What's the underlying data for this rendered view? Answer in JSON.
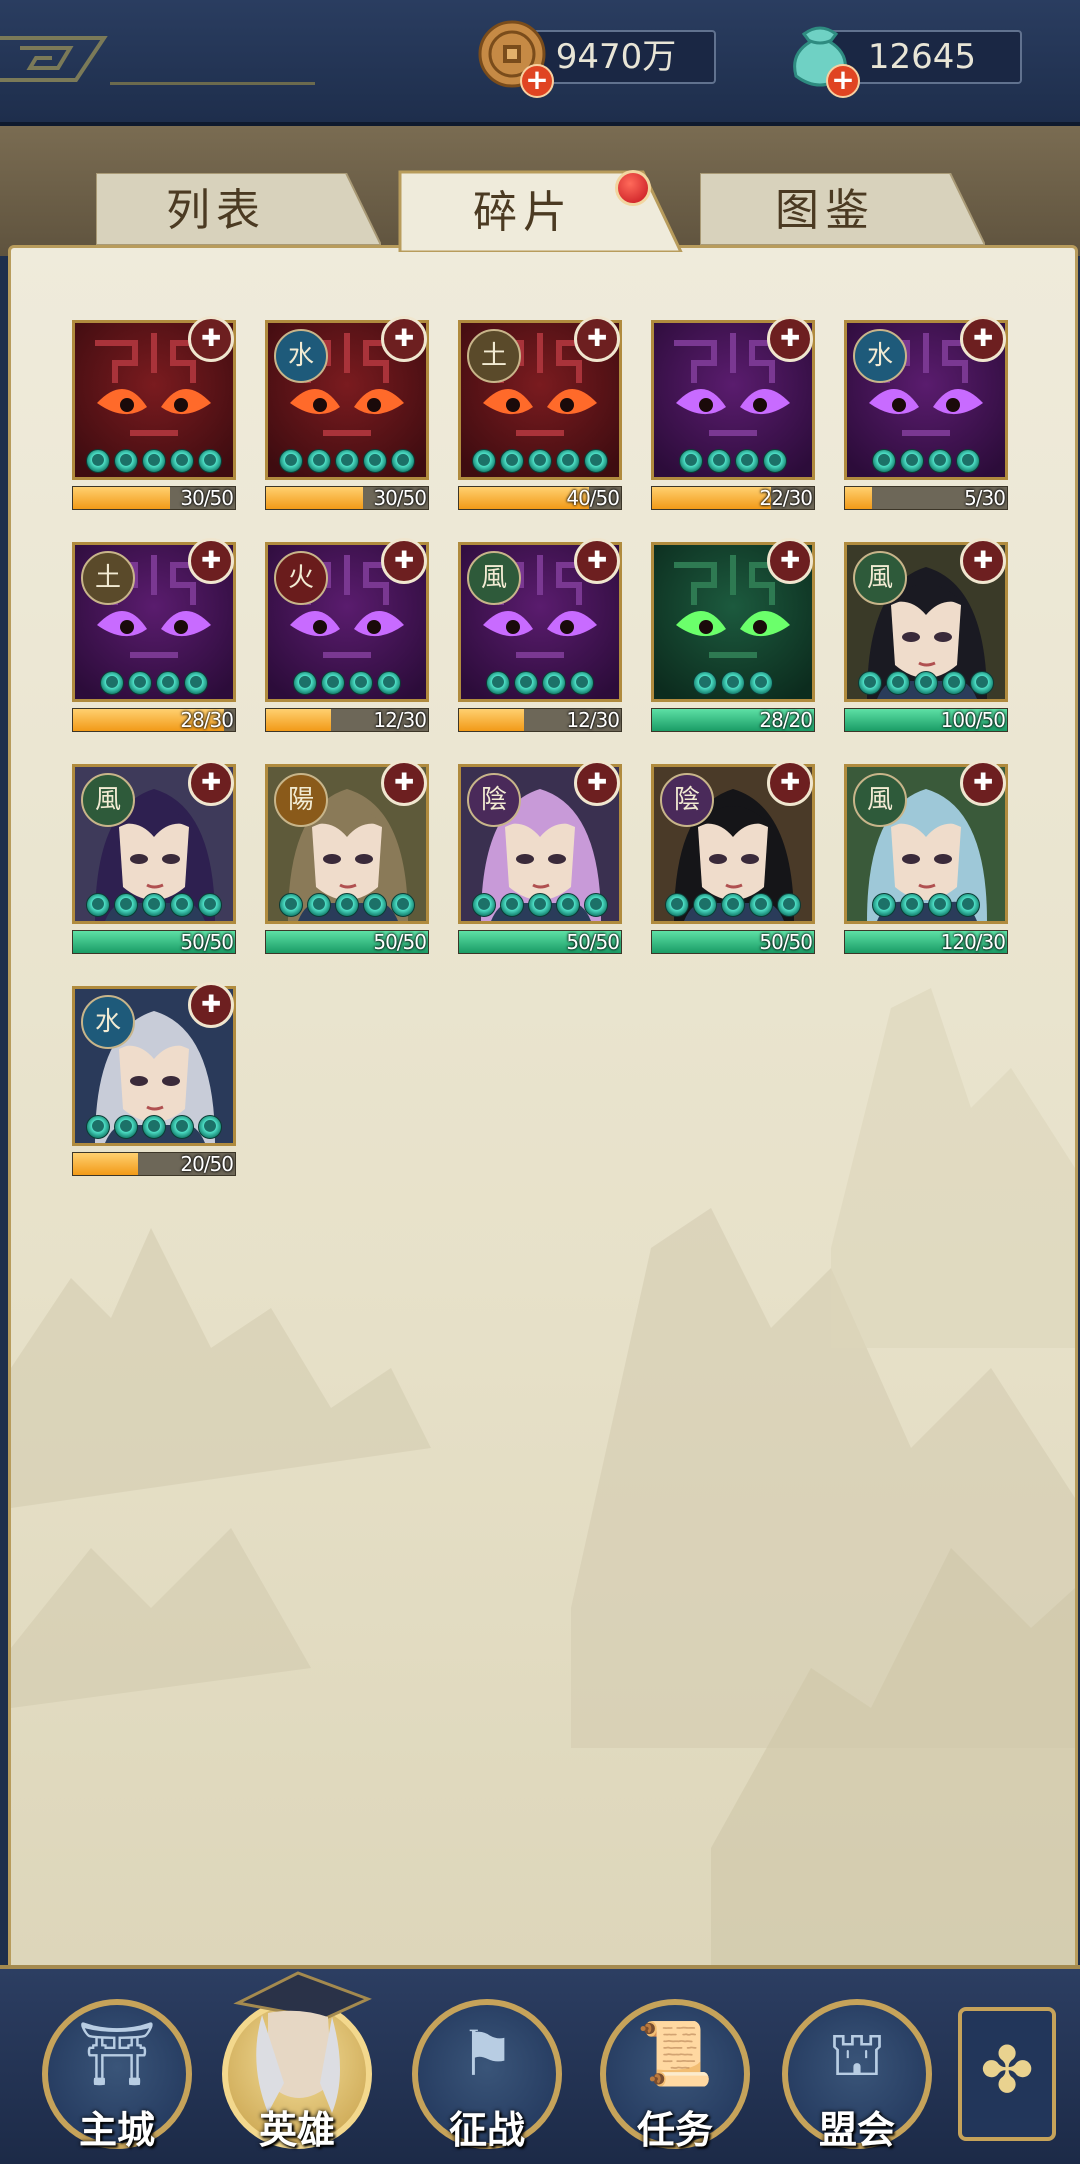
{
  "resources": {
    "coins": "9470万",
    "jade": "12645"
  },
  "tabs": [
    {
      "label": "列表"
    },
    {
      "label": "碎片"
    },
    {
      "label": "图鉴"
    }
  ],
  "active_tab": "碎片",
  "fragments": [
    {
      "element": "",
      "stars": 5,
      "current": 30,
      "required": 50,
      "progress": "30/50",
      "bar_color": "orange",
      "portrait": "red-mask"
    },
    {
      "element": "水",
      "stars": 5,
      "current": 30,
      "required": 50,
      "progress": "30/50",
      "bar_color": "orange",
      "portrait": "red-mask"
    },
    {
      "element": "土",
      "stars": 5,
      "current": 40,
      "required": 50,
      "progress": "40/50",
      "bar_color": "orange",
      "portrait": "red-mask"
    },
    {
      "element": "",
      "stars": 4,
      "current": 22,
      "required": 30,
      "progress": "22/30",
      "bar_color": "orange",
      "portrait": "purple-mask"
    },
    {
      "element": "水",
      "stars": 4,
      "current": 5,
      "required": 30,
      "progress": "5/30",
      "bar_color": "orange",
      "portrait": "purple-mask"
    },
    {
      "element": "土",
      "stars": 4,
      "current": 28,
      "required": 30,
      "progress": "28/30",
      "bar_color": "orange",
      "portrait": "purple-mask"
    },
    {
      "element": "火",
      "stars": 4,
      "current": 12,
      "required": 30,
      "progress": "12/30",
      "bar_color": "orange",
      "portrait": "purple-mask"
    },
    {
      "element": "風",
      "stars": 4,
      "current": 12,
      "required": 30,
      "progress": "12/30",
      "bar_color": "orange",
      "portrait": "purple-mask"
    },
    {
      "element": "",
      "stars": 3,
      "current": 28,
      "required": 20,
      "progress": "28/20",
      "bar_color": "green",
      "portrait": "green-mask"
    },
    {
      "element": "風",
      "stars": 5,
      "current": 100,
      "required": 50,
      "progress": "100/50",
      "bar_color": "green",
      "portrait": "hero-dark-hair"
    },
    {
      "element": "風",
      "stars": 5,
      "current": 50,
      "required": 50,
      "progress": "50/50",
      "bar_color": "green",
      "portrait": "hero-purple-hair"
    },
    {
      "element": "陽",
      "stars": 5,
      "current": 50,
      "required": 50,
      "progress": "50/50",
      "bar_color": "green",
      "portrait": "hero-brown-hair"
    },
    {
      "element": "陰",
      "stars": 5,
      "current": 50,
      "required": 50,
      "progress": "50/50",
      "bar_color": "green",
      "portrait": "hero-pink-hair"
    },
    {
      "element": "陰",
      "stars": 5,
      "current": 50,
      "required": 50,
      "progress": "50/50",
      "bar_color": "green",
      "portrait": "hero-black-hair"
    },
    {
      "element": "風",
      "stars": 4,
      "current": 120,
      "required": 30,
      "progress": "120/30",
      "bar_color": "green",
      "portrait": "hero-blue-hair"
    },
    {
      "element": "水",
      "stars": 5,
      "current": 20,
      "required": 50,
      "progress": "20/50",
      "bar_color": "orange",
      "portrait": "hero-silver-hair"
    }
  ],
  "nav": [
    {
      "label": "主城",
      "icon": "palace-icon"
    },
    {
      "label": "英雄",
      "icon": "hero-icon"
    },
    {
      "label": "征战",
      "icon": "battle-icon"
    },
    {
      "label": "任务",
      "icon": "quest-icon"
    },
    {
      "label": "盟会",
      "icon": "alliance-icon"
    }
  ],
  "colors": {
    "frame_blue": "#1f2f4c",
    "panel": "#ece7d3",
    "gold": "#c6a35a",
    "progress_orange": "#f29a18",
    "progress_green": "#1a9c66"
  }
}
